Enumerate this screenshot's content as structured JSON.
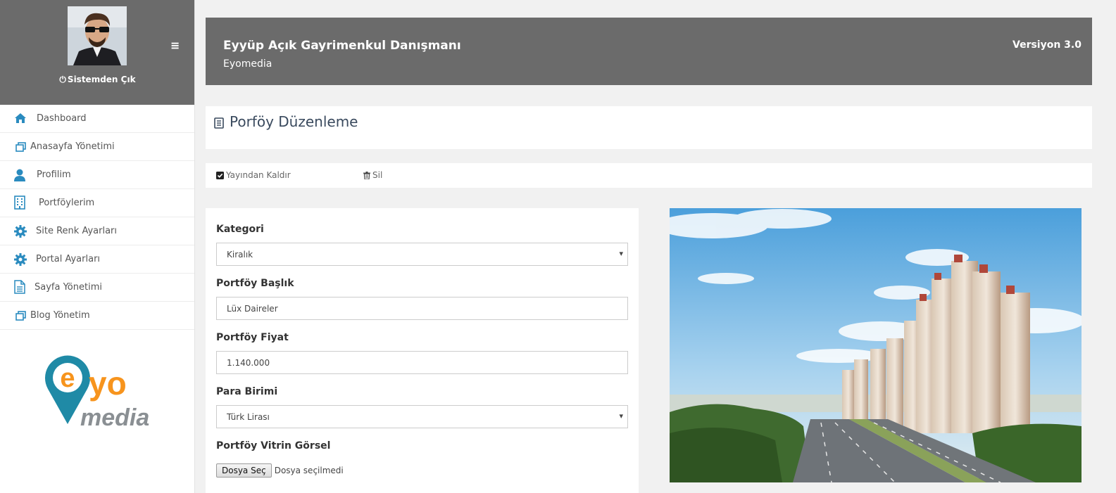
{
  "sidebar": {
    "logout_label": "Sistemden Çık",
    "menu_icon": "hamburger-icon",
    "items": [
      {
        "label": "Dashboard",
        "icon": "home-icon"
      },
      {
        "label": "Anasayfa Yönetimi",
        "icon": "windows-icon"
      },
      {
        "label": "Profilim",
        "icon": "user-icon"
      },
      {
        "label": "Portföylerim",
        "icon": "building-icon"
      },
      {
        "label": "Site Renk Ayarları",
        "icon": "gear-icon"
      },
      {
        "label": "Portal Ayarları",
        "icon": "gear-icon"
      },
      {
        "label": "Sayfa Yönetimi",
        "icon": "document-icon"
      },
      {
        "label": "Blog Yönetim",
        "icon": "windows-icon"
      }
    ],
    "logo": {
      "part1": "e",
      "part2": "yo",
      "part3": "media"
    }
  },
  "header": {
    "title": "Eyyüp Açık Gayrimenkul Danışmanı",
    "subtitle": "Eyomedia",
    "version": "Versiyon 3.0"
  },
  "page": {
    "title": "Porföy Düzenleme"
  },
  "actions": {
    "unpublish": "Yayından Kaldır",
    "delete": "Sil"
  },
  "form": {
    "category_label": "Kategori",
    "category_value": "Kiralık",
    "title_label": "Portföy Başlık",
    "title_value": "Lüx Daireler",
    "price_label": "Portföy Fiyat",
    "price_value": "1.140.000",
    "currency_label": "Para Birimi",
    "currency_value": "Türk Lirası",
    "image_label": "Portföy Vitrin Görsel",
    "file_button": "Dosya Seç",
    "file_status": "Dosya seçilmedi"
  },
  "colors": {
    "header_bg": "#6b6b6b",
    "nav_icon": "#2a8bbf",
    "logo_orange": "#f7941d",
    "logo_teal": "#1f8aa6",
    "logo_gray": "#8a8f93"
  }
}
